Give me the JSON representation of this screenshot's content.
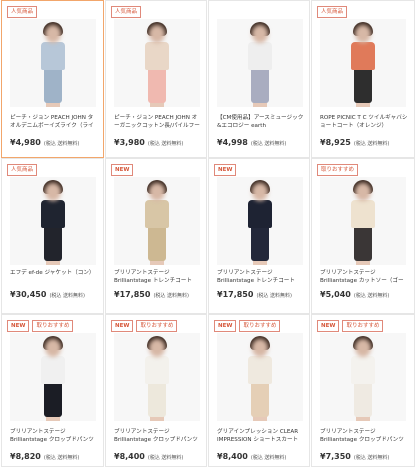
{
  "products": [
    {
      "badges": [
        "人気商品"
      ],
      "title": "ピーチ・ジョン PEACH JOHN タオルデニムボーイズライク（ライトインディゴ）",
      "price": "¥4,980",
      "tax": "(税込 送料無料)",
      "top_color": "#b7c7d8",
      "bottom_color": "#9fb3c8",
      "selected": true
    },
    {
      "badges": [
        "人気商品"
      ],
      "title": "ピーチ・ジョン PEACH JOHN オーガニックコットン長/パイルフーディ（ボーダー）",
      "price": "¥3,980",
      "tax": "(税込 送料無料)",
      "top_color": "#e9d7c7",
      "bottom_color": "#f0b9b0"
    },
    {
      "badges": [],
      "title": "【CM使用品】アースミュージック&エコロジー earth music&ecology",
      "price": "¥4,998",
      "tax": "(税込 送料無料)",
      "top_color": "#eeeeee",
      "bottom_color": "#a9adc0"
    },
    {
      "badges": [
        "人気商品"
      ],
      "title": "ROPE PICNIC T C ツイルギャバショートコート（オレンジ）",
      "price": "¥8,925",
      "tax": "(税込 送料無料)",
      "top_color": "#e07a5a",
      "bottom_color": "#2e2e2e"
    },
    {
      "badges": [
        "人気商品"
      ],
      "title": "エフデ ef-de ジャケット（コン）",
      "price": "¥30,450",
      "tax": "(税込 送料無料)",
      "top_color": "#1f2430",
      "bottom_color": "#22242c"
    },
    {
      "badges": [
        "NEW"
      ],
      "title": "ブリリアントステージ Brilliantstage トレンチコート（ベージュ）",
      "price": "¥17,850",
      "tax": "(税込 送料無料)",
      "top_color": "#d8c6a6",
      "bottom_color": "#cdb892"
    },
    {
      "badges": [
        "NEW"
      ],
      "title": "ブリリアントステージ Brilliantstage トレンチコート（コン）",
      "price": "¥17,850",
      "tax": "(税込 送料無料)",
      "top_color": "#1e2333",
      "bottom_color": "#23283a"
    },
    {
      "badges": [
        "取りおすすめ"
      ],
      "title": "ブリリアントステージ Brilliantstage カットソー（ゴールド）",
      "price": "¥5,040",
      "tax": "(税込 送料無料)",
      "top_color": "#eee2cf",
      "bottom_color": "#3a3636"
    },
    {
      "badges": [
        "NEW",
        "取りおすすめ"
      ],
      "title": "ブリリアントステージ Brilliantstage クロップドパンツ（コン）",
      "price": "¥8,820",
      "tax": "(税込 送料無料)",
      "top_color": "#f0f0f0",
      "bottom_color": "#1b1d25"
    },
    {
      "badges": [
        "NEW",
        "取りおすすめ"
      ],
      "title": "ブリリアントステージ Brilliantstage クロップドパンツ（オフシロ）",
      "price": "¥8,400",
      "tax": "(税込 送料無料)",
      "top_color": "#f3f1ec",
      "bottom_color": "#ede8dc"
    },
    {
      "badges": [
        "NEW",
        "取りおすすめ"
      ],
      "title": "グリアインプレッション CLEAR IMPRESSION ショートスカート（ベージュ）",
      "price": "¥8,400",
      "tax": "(税込 送料無料)",
      "top_color": "#efe9df",
      "bottom_color": "#e5cfb6"
    },
    {
      "badges": [
        "NEW",
        "取りおすすめ"
      ],
      "title": "ブリリアントステージ Brilliantstage クロップドパンツ（オフシロ）",
      "price": "¥7,350",
      "tax": "(税込 送料無料)",
      "top_color": "#f4f2ee",
      "bottom_color": "#efeae2"
    }
  ]
}
